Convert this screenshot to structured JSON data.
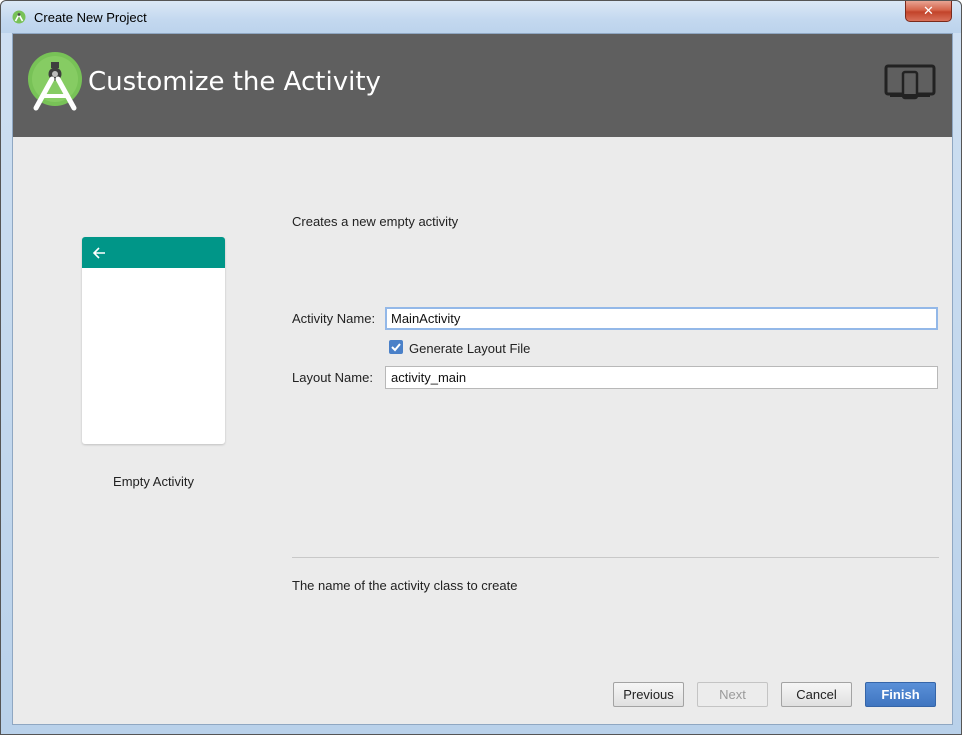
{
  "window": {
    "title": "Create New Project",
    "close_label": "✕"
  },
  "header": {
    "title": "Customize the Activity",
    "logo_icon": "android-studio-icon",
    "device_icon": "devices-icon"
  },
  "preview": {
    "template_name": "Empty Activity",
    "appbar_color": "#009688"
  },
  "form": {
    "description": "Creates a new empty activity",
    "activity_name_label": "Activity Name:",
    "activity_name_value": "MainActivity",
    "generate_layout_label": "Generate Layout File",
    "generate_layout_checked": true,
    "layout_name_label": "Layout Name:",
    "layout_name_value": "activity_main"
  },
  "hint": "The name of the activity class to create",
  "buttons": {
    "previous": "Previous",
    "next": "Next",
    "cancel": "Cancel",
    "finish": "Finish"
  },
  "colors": {
    "header_bg": "#5f5f5f",
    "accent": "#3f75c0",
    "android_green": "#78c257"
  }
}
